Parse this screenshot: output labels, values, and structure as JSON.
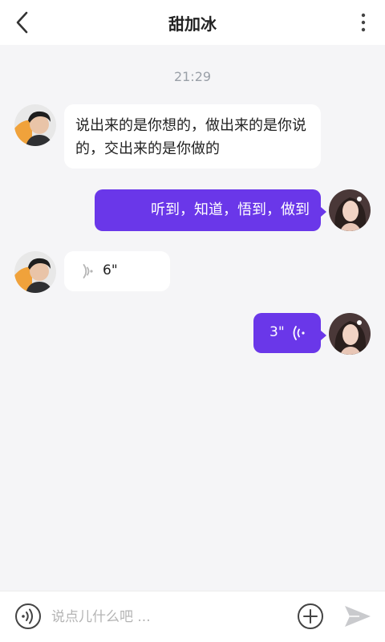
{
  "header": {
    "title": "甜加冰",
    "back_icon": "chevron-left-icon",
    "more_icon": "more-vertical-icon"
  },
  "chat": {
    "timestamp": "21:29",
    "messages": [
      {
        "side": "left",
        "type": "text",
        "text": "说出来的是你想的，做出来的是你说的，交出来的是你做的"
      },
      {
        "side": "right",
        "type": "text",
        "text": "听到，知道，悟到，做到"
      },
      {
        "side": "left",
        "type": "voice",
        "duration": "6\""
      },
      {
        "side": "right",
        "type": "voice",
        "duration": "3\""
      }
    ]
  },
  "input_bar": {
    "placeholder": "说点儿什么吧 ...",
    "voice_icon": "voice-toggle-icon",
    "add_icon": "plus-circle-icon",
    "send_icon": "send-icon"
  },
  "colors": {
    "accent": "#6a37e9",
    "background": "#f5f5f7",
    "bubble_left": "#ffffff"
  }
}
